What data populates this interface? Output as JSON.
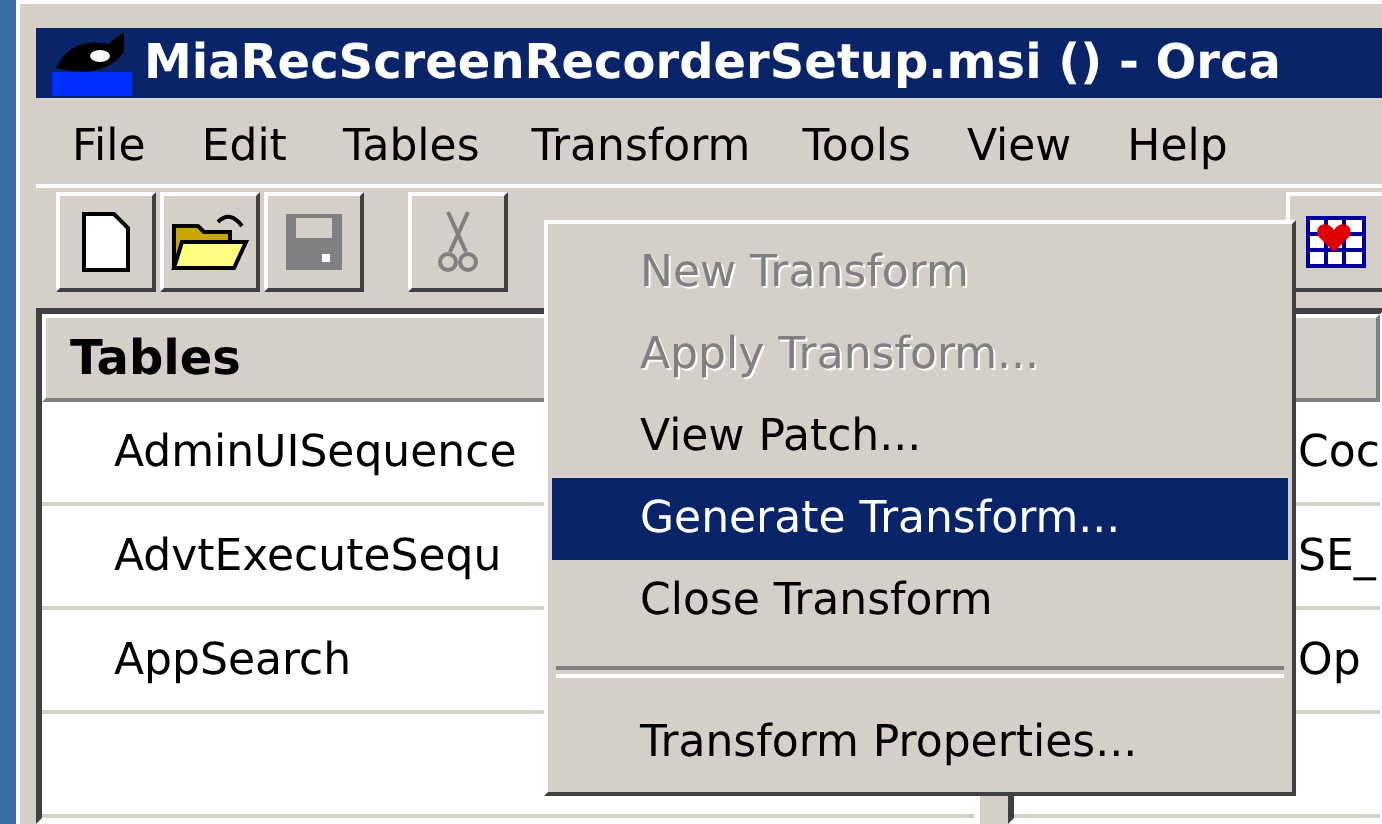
{
  "window": {
    "title": "MiaRecScreenRecorderSetup.msi () - Orca"
  },
  "menu_bar": [
    {
      "label": "File",
      "selected": false
    },
    {
      "label": "Edit",
      "selected": false
    },
    {
      "label": "Tables",
      "selected": false
    },
    {
      "label": "Transform",
      "selected": true
    },
    {
      "label": "Tools",
      "selected": false
    },
    {
      "label": "View",
      "selected": false
    },
    {
      "label": "Help",
      "selected": false
    }
  ],
  "toolbar": [
    {
      "kind": "new",
      "disabled": false
    },
    {
      "kind": "open",
      "disabled": false
    },
    {
      "kind": "save",
      "disabled": true
    },
    {
      "kind": "cut",
      "disabled": true
    },
    {
      "kind": "grid",
      "disabled": false
    }
  ],
  "tables_panel": {
    "header": "Tables",
    "rows": [
      "AdminUISequence",
      "AdvtExecuteSequ",
      "AppSearch"
    ]
  },
  "detail_panel": {
    "cells": [
      "Coc",
      "SE_",
      "Op"
    ]
  },
  "transform_menu": {
    "items": [
      {
        "kind": "item",
        "label": "New Transform",
        "disabled": true,
        "selected": false
      },
      {
        "kind": "item",
        "label": "Apply Transform...",
        "disabled": true,
        "selected": false
      },
      {
        "kind": "item",
        "label": "View Patch...",
        "disabled": false,
        "selected": false
      },
      {
        "kind": "item",
        "label": "Generate Transform...",
        "disabled": false,
        "selected": true
      },
      {
        "kind": "item",
        "label": "Close Transform",
        "disabled": false,
        "selected": false
      },
      {
        "kind": "separator"
      },
      {
        "kind": "item",
        "label": "Transform Properties...",
        "disabled": false,
        "selected": false
      }
    ]
  }
}
